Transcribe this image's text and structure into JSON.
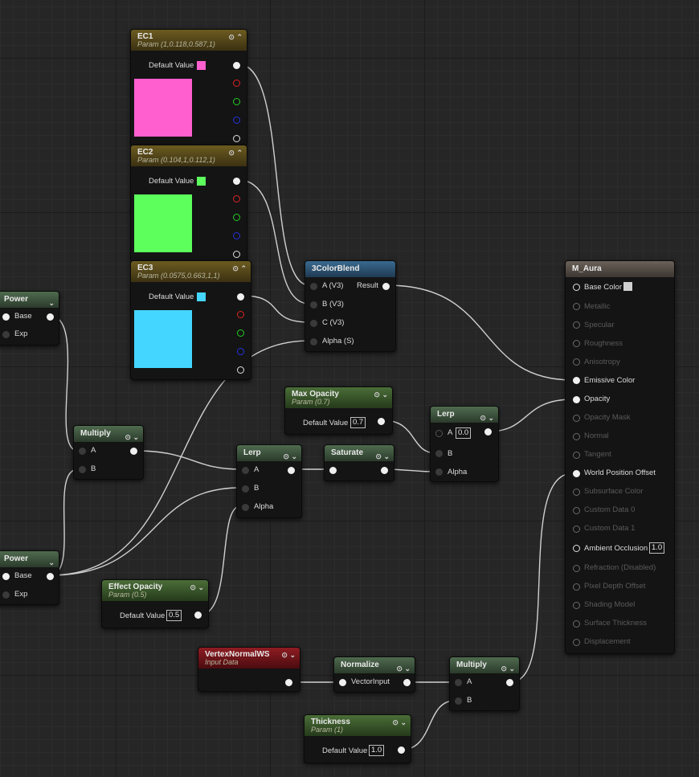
{
  "ec1": {
    "title": "EC1",
    "sub": "Param (1,0.118,0.587,1)",
    "default_label": "Default Value",
    "color": "#ff5fcf"
  },
  "ec2": {
    "title": "EC2",
    "sub": "Param (0.104,1,0.112,1)",
    "default_label": "Default Value",
    "color": "#5cff5c"
  },
  "ec3": {
    "title": "EC3",
    "sub": "Param (0.0575,0.663,1,1)",
    "default_label": "Default Value",
    "color": "#45d6ff"
  },
  "blend": {
    "title": "3ColorBlend",
    "a": "A (V3)",
    "b": "B (V3)",
    "c": "C (V3)",
    "alpha": "Alpha (S)",
    "result": "Result"
  },
  "power1": {
    "title": "Power",
    "base": "Base",
    "exp": "Exp"
  },
  "power2": {
    "title": "Power",
    "base": "Base",
    "exp": "Exp"
  },
  "multiply1": {
    "title": "Multiply",
    "a": "A",
    "b": "B"
  },
  "lerp1": {
    "title": "Lerp",
    "a": "A",
    "b": "B",
    "alpha": "Alpha"
  },
  "saturate": {
    "title": "Saturate"
  },
  "maxopacity": {
    "title": "Max Opacity",
    "sub": "Param (0.7)",
    "default_label": "Default Value",
    "value": "0.7"
  },
  "lerp2": {
    "title": "Lerp",
    "a": "A",
    "a_value": "0.0",
    "b": "B",
    "alpha": "Alpha"
  },
  "effectopacity": {
    "title": "Effect Opacity",
    "sub": "Param (0.5)",
    "default_label": "Default Value",
    "value": "0.5"
  },
  "vertexnormal": {
    "title": "VertexNormalWS",
    "sub": "Input Data"
  },
  "normalize": {
    "title": "Normalize",
    "input": "VectorInput"
  },
  "multiply2": {
    "title": "Multiply",
    "a": "A",
    "b": "B"
  },
  "thickness": {
    "title": "Thickness",
    "sub": "Param (1)",
    "default_label": "Default Value",
    "value": "1.0"
  },
  "material": {
    "title": "M_Aura",
    "base_color": "Base Color",
    "metallic": "Metallic",
    "specular": "Specular",
    "roughness": "Roughness",
    "anisotropy": "Anisotropy",
    "emissive": "Emissive Color",
    "opacity": "Opacity",
    "opacity_mask": "Opacity Mask",
    "normal": "Normal",
    "tangent": "Tangent",
    "wpo": "World Position Offset",
    "subsurface": "Subsurface Color",
    "custom0": "Custom Data 0",
    "custom1": "Custom Data 1",
    "ao": "Ambient Occlusion",
    "ao_value": "1.0",
    "refraction": "Refraction (Disabled)",
    "pixel_depth": "Pixel Depth Offset",
    "shading_model": "Shading Model",
    "surface_thickness": "Surface Thickness",
    "displacement": "Displacement"
  }
}
